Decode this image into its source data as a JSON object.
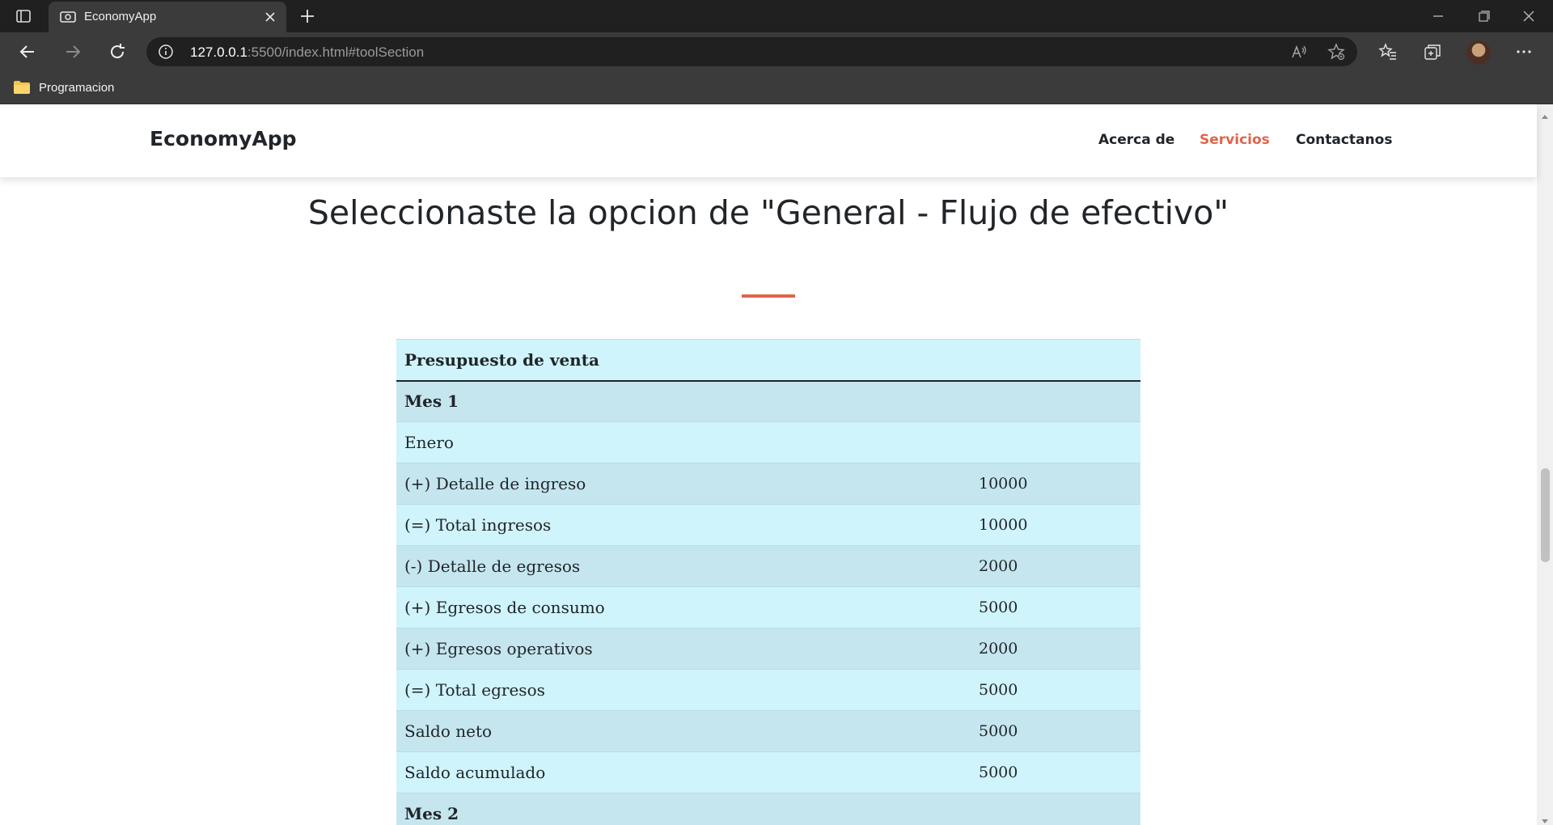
{
  "browser": {
    "tab_title": "EconomyApp",
    "url_host": "127.0.0.1",
    "url_rest": ":5500/index.html#toolSection",
    "bookmark_folder": "Programacion"
  },
  "site": {
    "brand": "EconomyApp",
    "nav": {
      "about": "Acerca de",
      "services": "Servicios",
      "contact": "Contactanos"
    },
    "accent_color": "#e0644b"
  },
  "section": {
    "title": "Seleccionaste la opcion de \"General - Flujo de efectivo\""
  },
  "table": {
    "header": "Presupuesto de venta",
    "rows": [
      {
        "label": "Mes 1",
        "value": ""
      },
      {
        "label": "Enero",
        "value": ""
      },
      {
        "label": "(+) Detalle de ingreso",
        "value": "10000"
      },
      {
        "label": "(=) Total ingresos",
        "value": "10000"
      },
      {
        "label": "(-) Detalle de egresos",
        "value": "2000"
      },
      {
        "label": "(+) Egresos de consumo",
        "value": "5000"
      },
      {
        "label": "(+) Egresos operativos",
        "value": "2000"
      },
      {
        "label": "(=) Total egresos",
        "value": "5000"
      },
      {
        "label": "Saldo neto",
        "value": "5000"
      },
      {
        "label": "Saldo acumulado",
        "value": "5000"
      },
      {
        "label": "Mes 2",
        "value": ""
      }
    ]
  }
}
